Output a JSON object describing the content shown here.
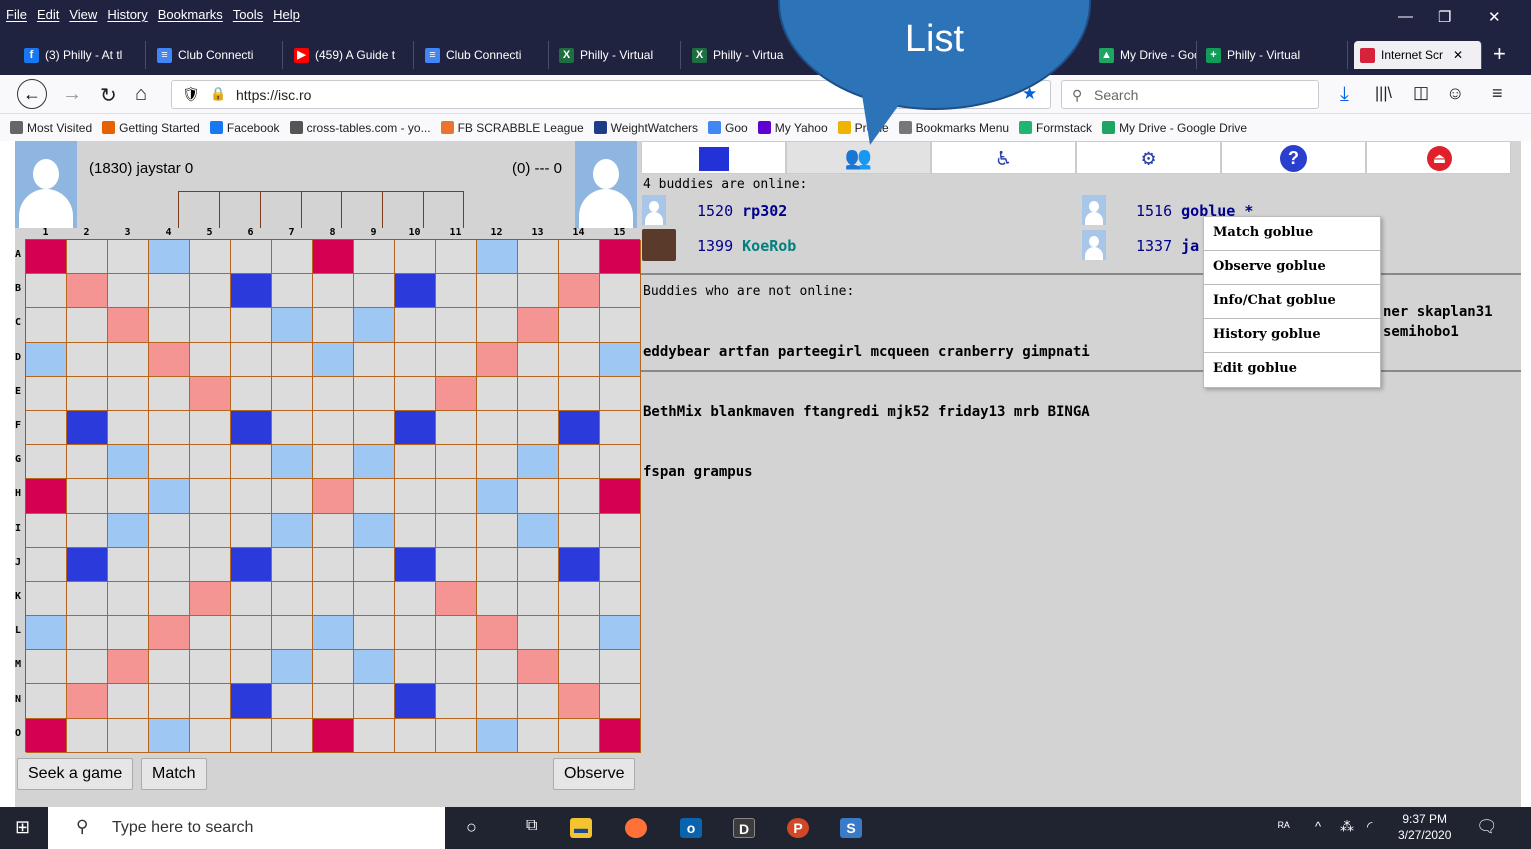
{
  "browser": {
    "menu": [
      "File",
      "Edit",
      "View",
      "History",
      "Bookmarks",
      "Tools",
      "Help"
    ],
    "tabs": [
      {
        "label": "(3) Philly - At tl",
        "color": "#1877f2",
        "glyph": "f"
      },
      {
        "label": "Club Connecti",
        "color": "#4285f4",
        "glyph": "≡"
      },
      {
        "label": "(459) A Guide t",
        "color": "#ff0000",
        "glyph": "▶"
      },
      {
        "label": "Club Connecti",
        "color": "#4285f4",
        "glyph": "≡"
      },
      {
        "label": "Philly - Virtual",
        "color": "#1d6f42",
        "glyph": "X"
      },
      {
        "label": "Philly - Virtua",
        "color": "#1d6f42",
        "glyph": "X"
      },
      {
        "label": "My Drive - Goo",
        "color": "#1fa463",
        "glyph": "▲"
      },
      {
        "label": "Philly - Virtual",
        "color": "#0f9d58",
        "glyph": "+"
      },
      {
        "label": "Internet Scr",
        "color": "#d6233b",
        "glyph": " "
      }
    ],
    "url": "https://isc.ro",
    "search_placeholder": "Search",
    "bookmarks": [
      {
        "label": "Most Visited",
        "color": "#666"
      },
      {
        "label": "Getting Started",
        "color": "#e66000"
      },
      {
        "label": "Facebook",
        "color": "#1877f2"
      },
      {
        "label": "cross-tables.com - yo...",
        "color": "#555"
      },
      {
        "label": "FB SCRABBLE League",
        "color": "#e8742f"
      },
      {
        "label": "WeightWatchers",
        "color": "#1f3c88"
      },
      {
        "label": "Goo",
        "color": "#4285f4"
      },
      {
        "label": "My Yahoo",
        "color": "#6001d2"
      },
      {
        "label": "Profile",
        "color": "#f0b400"
      },
      {
        "label": "Bookmarks Menu",
        "color": "#777"
      },
      {
        "label": "Formstack",
        "color": "#21b573"
      },
      {
        "label": "My Drive - Google Drive",
        "color": "#1fa463"
      }
    ]
  },
  "callout": {
    "text": "List"
  },
  "game": {
    "player": "(1830) jaystar 0",
    "opponent": "(0) --- 0",
    "columns": [
      "1",
      "2",
      "3",
      "4",
      "5",
      "6",
      "7",
      "8",
      "9",
      "10",
      "11",
      "12",
      "13",
      "14",
      "15"
    ],
    "rows": [
      "A",
      "B",
      "C",
      "D",
      "E",
      "F",
      "G",
      "H",
      "I",
      "J",
      "K",
      "L",
      "M",
      "N",
      "O"
    ],
    "buttons": {
      "seek": "Seek a game",
      "match": "Match",
      "observe": "Observe"
    },
    "colors": {
      "tw": "#d5004f",
      "dw": "#f49593",
      "tl": "#2b3bdb",
      "dl": "#9ec8f3",
      "plain": "#dcdcdc"
    }
  },
  "buddies": {
    "online_header": "4 buddies are online:",
    "online": [
      {
        "rating": "1520",
        "name": "rp302",
        "name_color": "#00008b"
      },
      {
        "rating": "1516",
        "name": "goblue *",
        "name_color": "#00008b"
      },
      {
        "rating": "1399",
        "name": "KoeRob",
        "name_color": "#008080"
      },
      {
        "rating": "1337",
        "name": "ja",
        "name_color": "#00008b"
      }
    ],
    "offline_header": "Buddies who are not online:",
    "offline_lines": [
      "eddybear artfan parteegirl mcqueen cranberry gimpnati",
      "BethMix blankmaven ftangredi mjk52 friday13 mrb BINGA",
      "fspan grampus"
    ],
    "offline_tail_1": "ner skaplan31",
    "offline_tail_2": "semihobo1",
    "context_menu": [
      "Match goblue",
      "Observe goblue",
      "Info/Chat goblue",
      "History goblue",
      "Edit goblue"
    ]
  },
  "taskbar": {
    "search_placeholder": "Type here to search",
    "time": "9:37 PM",
    "date": "3/27/2020"
  }
}
